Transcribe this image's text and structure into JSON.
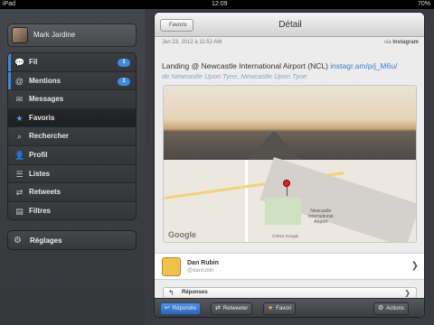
{
  "status": {
    "device": "iPad",
    "time": "12:09",
    "battery": "70%"
  },
  "account": {
    "name": "Mark Jardine"
  },
  "menu": {
    "items": [
      {
        "label": "Fil",
        "icon": "speech-bubble-icon",
        "badge": "1"
      },
      {
        "label": "Mentions",
        "icon": "at-icon",
        "badge": "1"
      },
      {
        "label": "Messages",
        "icon": "envelope-icon",
        "badge": ""
      },
      {
        "label": "Favoris",
        "icon": "star-icon",
        "badge": ""
      },
      {
        "label": "Rechercher",
        "icon": "search-icon",
        "badge": ""
      },
      {
        "label": "Profil",
        "icon": "person-icon",
        "badge": ""
      },
      {
        "label": "Listes",
        "icon": "list-icon",
        "badge": ""
      },
      {
        "label": "Retweets",
        "icon": "retweet-icon",
        "badge": ""
      },
      {
        "label": "Filtres",
        "icon": "filter-icon",
        "badge": ""
      }
    ],
    "active_index": 3
  },
  "settings": {
    "label": "Réglages",
    "icon": "gear-icon"
  },
  "detail": {
    "back_label": "Favoris",
    "title": "Détail",
    "date": "Jan 23, 2012 à 11:52 AM",
    "via_prefix": "via",
    "via_app": "Instagram",
    "tweet_text": "Landing  @ Newcastle International Airport (NCL) ",
    "tweet_link": "instagr.am/p/j_M6u/",
    "location": "de Newcastle Upon Tyne, Newcastle Upon Tyne",
    "map": {
      "google": "Google",
      "airport_label": "Newcastle\nInternational\nAirport",
      "copyright": "©2012 Google"
    },
    "author": {
      "name": "Dan Rubin",
      "handle": "@danrubin"
    },
    "replies_label": "Réponses"
  },
  "toolbar": {
    "reply": "Répondre",
    "retweet": "Retweeter",
    "favorite": "Favori",
    "actions": "Actions"
  },
  "colors": {
    "accent": "#3b8be0",
    "link": "#3a7fc9"
  }
}
